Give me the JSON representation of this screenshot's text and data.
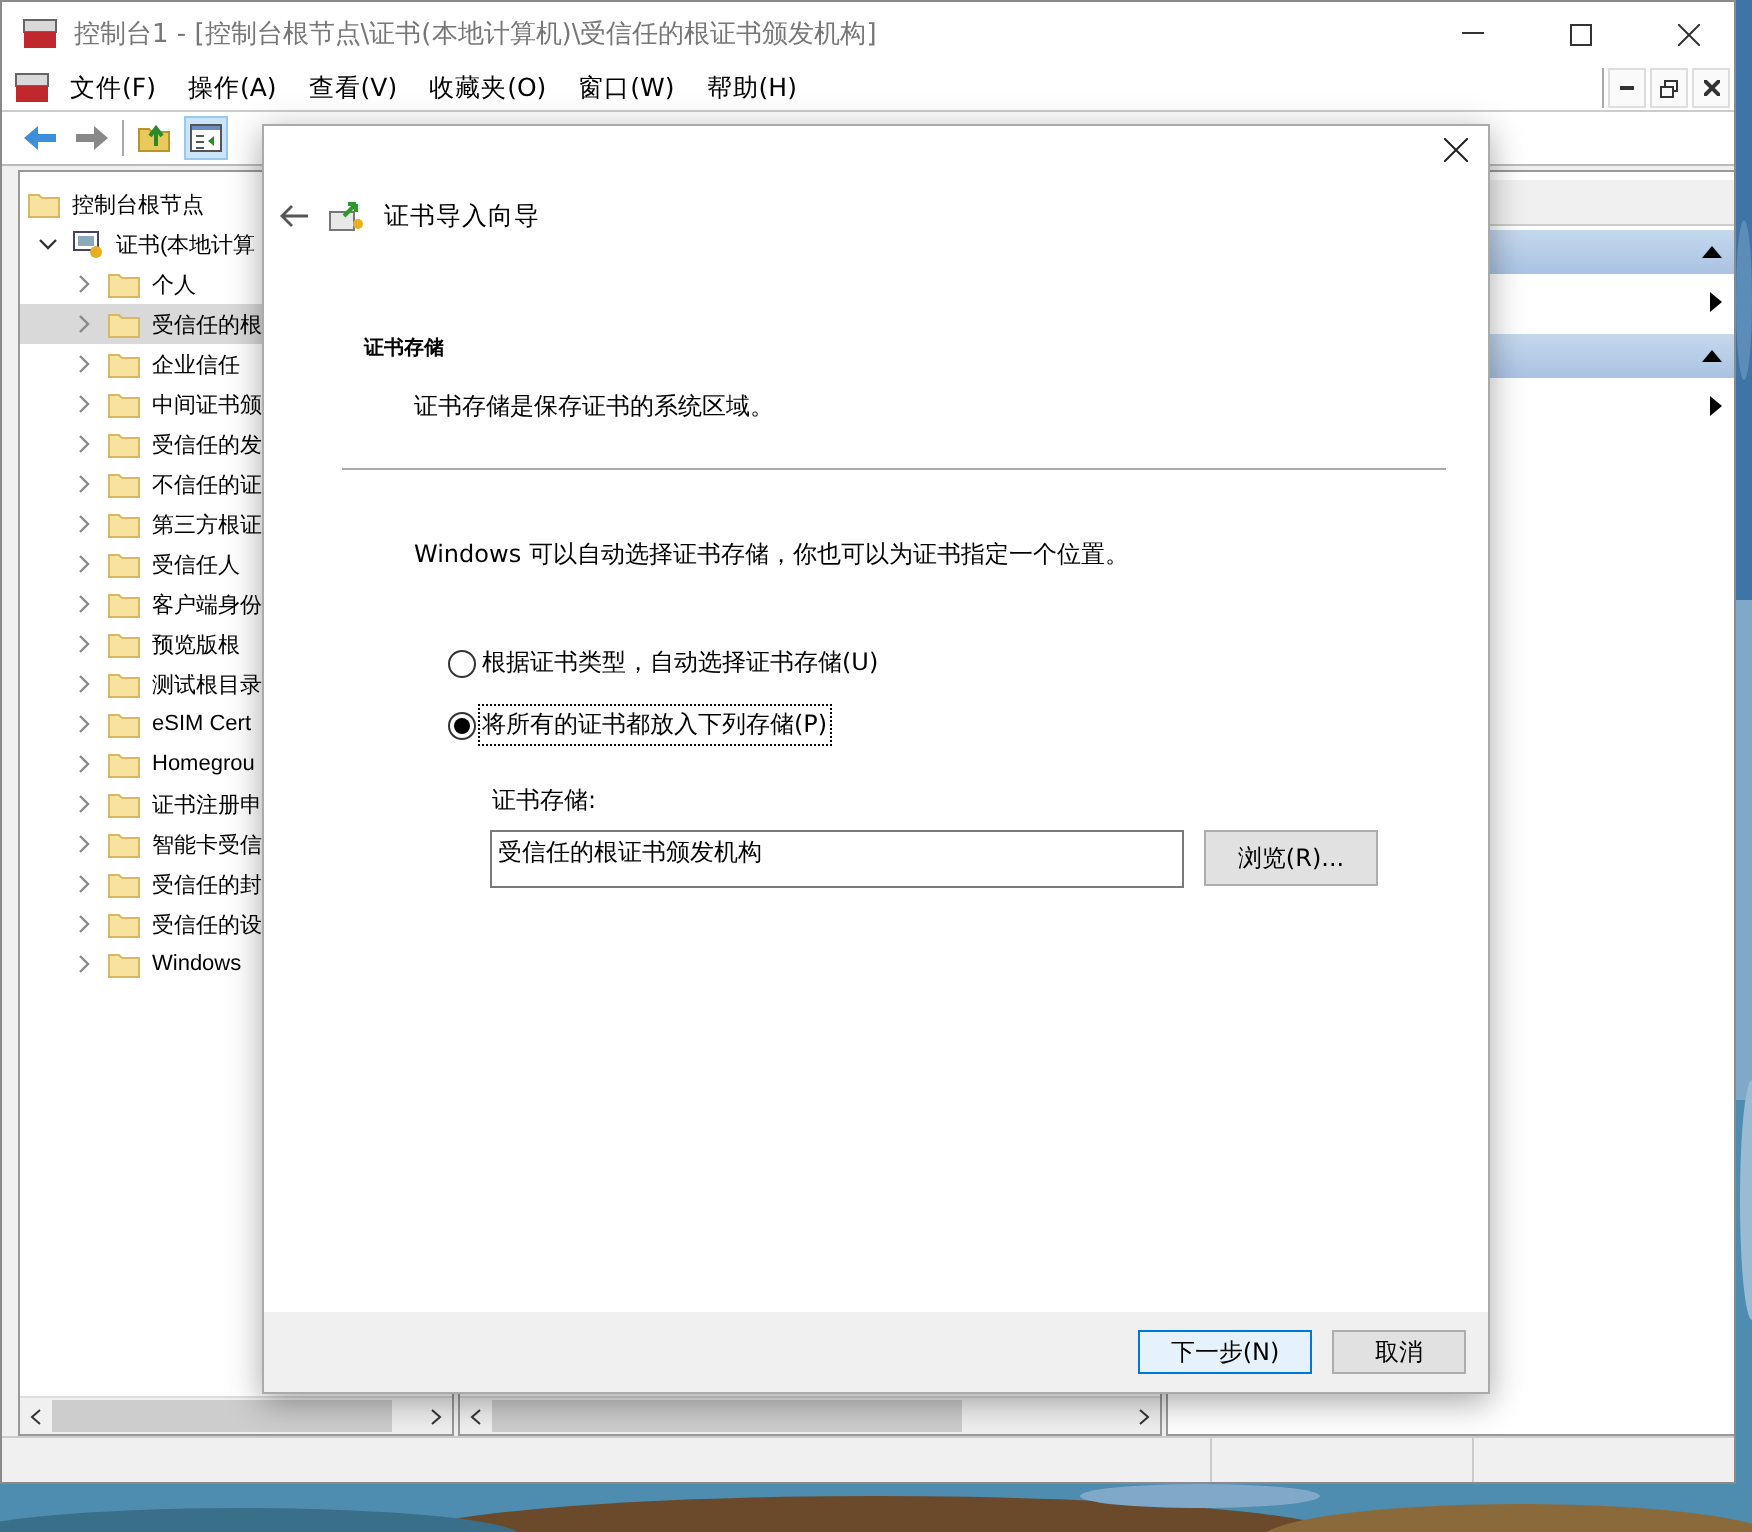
{
  "window": {
    "title": "控制台1 - [控制台根节点\\证书(本地计算机)\\受信任的根证书颁发机构]"
  },
  "menu": [
    "文件(F)",
    "操作(A)",
    "查看(V)",
    "收藏夹(O)",
    "窗口(W)",
    "帮助(H)"
  ],
  "toolbar": [
    {
      "kind": "back",
      "on": false
    },
    {
      "kind": "forward",
      "on": false
    },
    {
      "kind": "up",
      "on": false
    },
    {
      "kind": "tree",
      "on": true
    }
  ],
  "tree": [
    {
      "label": "控制台根节点",
      "children": [
        {
          "label": "证书(本地计算",
          "expanded": true,
          "selected": false,
          "children": [
            {
              "label": "个人",
              "expanded": false,
              "selected": false
            },
            {
              "label": "受信任的根",
              "expanded": false,
              "selected": true
            },
            {
              "label": "企业信任",
              "expanded": false,
              "selected": false
            },
            {
              "label": "中间证书颁",
              "expanded": false,
              "selected": false
            },
            {
              "label": "受信任的发",
              "expanded": false,
              "selected": false
            },
            {
              "label": "不信任的证",
              "expanded": false,
              "selected": false
            },
            {
              "label": "第三方根证",
              "expanded": false,
              "selected": false
            },
            {
              "label": "受信任人",
              "expanded": false,
              "selected": false
            },
            {
              "label": "客户端身份",
              "expanded": false,
              "selected": false
            },
            {
              "label": "预览版根",
              "expanded": false,
              "selected": false
            },
            {
              "label": "测试根目录",
              "expanded": false,
              "selected": false
            },
            {
              "label": "eSIM Cert",
              "expanded": false,
              "selected": false
            },
            {
              "label": "Homegrou",
              "expanded": false,
              "selected": false
            },
            {
              "label": "证书注册申",
              "expanded": false,
              "selected": false
            },
            {
              "label": "智能卡受信",
              "expanded": false,
              "selected": false
            },
            {
              "label": "受信任的封",
              "expanded": false,
              "selected": false
            },
            {
              "label": "受信任的设",
              "expanded": false,
              "selected": false
            },
            {
              "label": "Windows",
              "expanded": false,
              "selected": false
            }
          ]
        }
      ]
    }
  ],
  "dialog": {
    "title": "证书导入向导",
    "heading": "证书存储",
    "subheading": "证书存储是保存证书的系统区域。",
    "intro": "Windows 可以自动选择证书存储，你也可以为证书指定一个位置。",
    "options": [
      {
        "label": "根据证书类型，自动选择证书存储(U)",
        "selected": false
      },
      {
        "label": "将所有的证书都放入下列存储(P)",
        "selected": true
      }
    ],
    "store_label": "证书存储:",
    "store_value": "受信任的根证书颁发机构",
    "browse": "浏览(R)...",
    "buttons": [
      {
        "label": "下一步(N)",
        "default": true
      },
      {
        "label": "取消",
        "default": false
      }
    ]
  }
}
